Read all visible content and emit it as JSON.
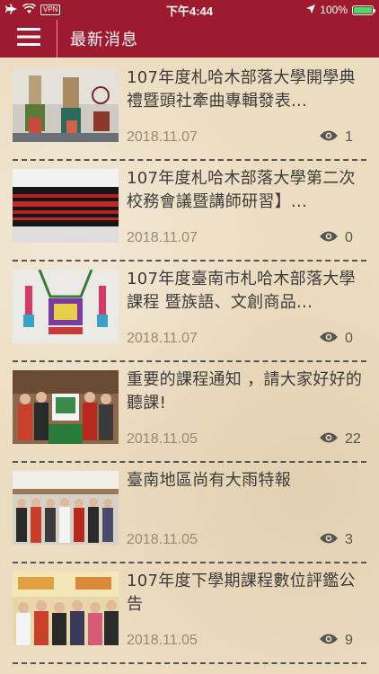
{
  "status": {
    "carrier_icon": "airplane-icon",
    "vpn": "VPN",
    "time": "下午4:44",
    "battery_percent": "100%",
    "battery_level": 1.0
  },
  "nav": {
    "title": "最新消息"
  },
  "items": [
    {
      "title": "107年度札哈木部落大學開學典禮暨頭社牽曲專輯發表...",
      "date": "2018.11.07",
      "views": "1"
    },
    {
      "title": "107年度札哈木部落大學第二次校務會議暨講師研習】...",
      "date": "2018.11.07",
      "views": "0"
    },
    {
      "title": "107年度臺南市札哈木部落大學課程 暨族語、文創商品...",
      "date": "2018.11.07",
      "views": "0"
    },
    {
      "title": "重要的課程通知 ，請大家好好的聽課!",
      "date": "2018.11.05",
      "views": "22"
    },
    {
      "title": "臺南地區尚有大雨特報",
      "date": "2018.11.05",
      "views": "3"
    },
    {
      "title": "107年度下學期課程數位評鑑公告",
      "date": "2018.11.05",
      "views": "9"
    }
  ],
  "colors": {
    "brand": "#9e1b2f",
    "background": "#ecdcc0"
  }
}
